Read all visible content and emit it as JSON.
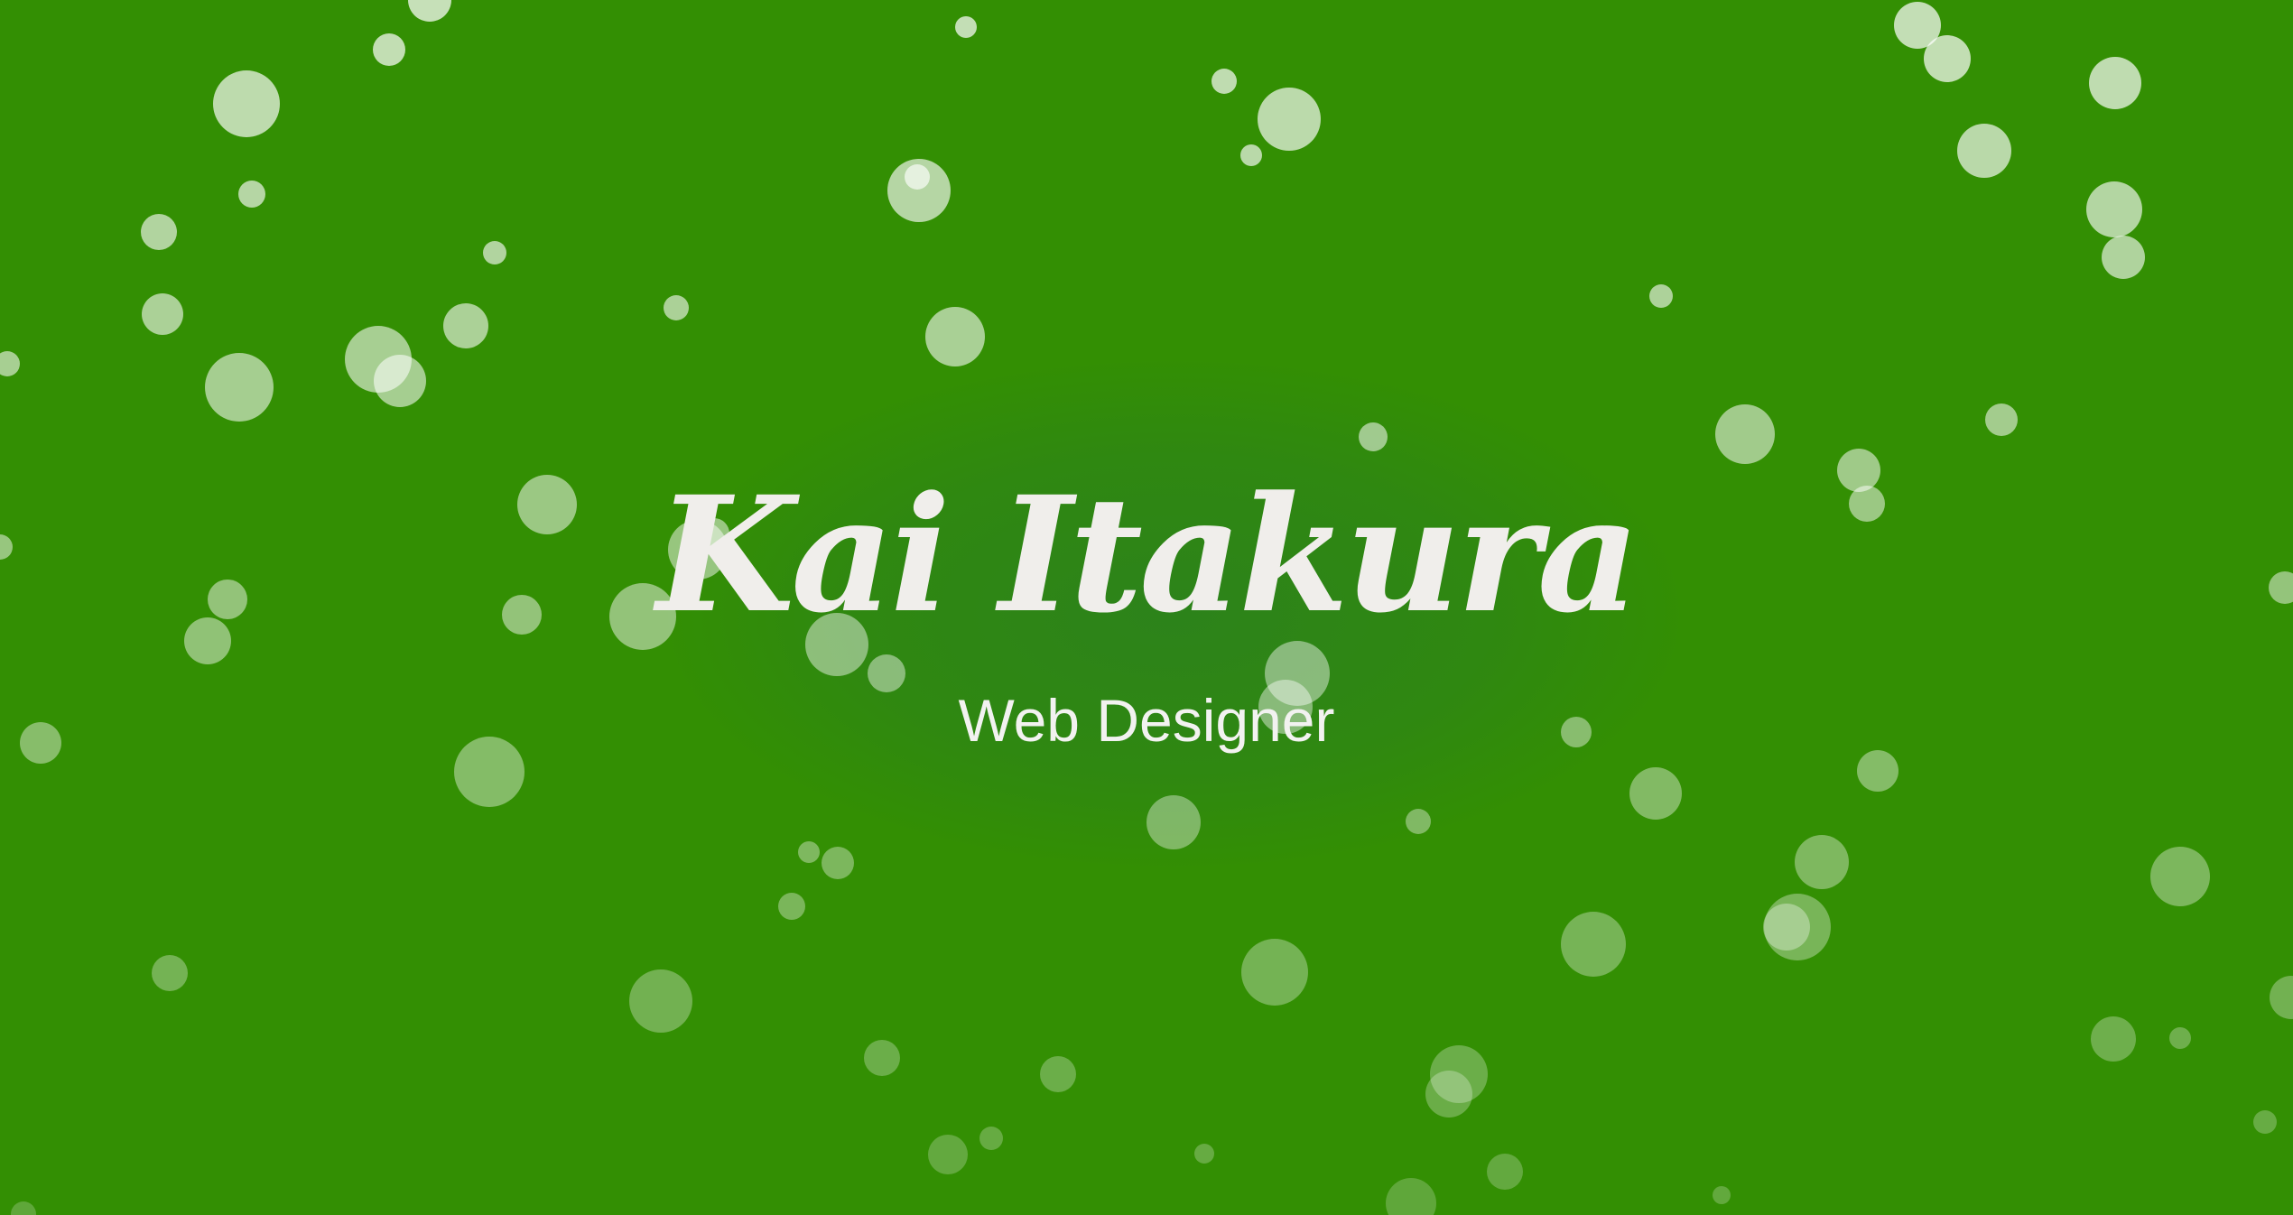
{
  "hero": {
    "name": "Kai Itakura",
    "role": "Web Designer"
  },
  "colors": {
    "background": "#338f03",
    "text": "#f0eeeb",
    "bubble": "#ffffff"
  }
}
